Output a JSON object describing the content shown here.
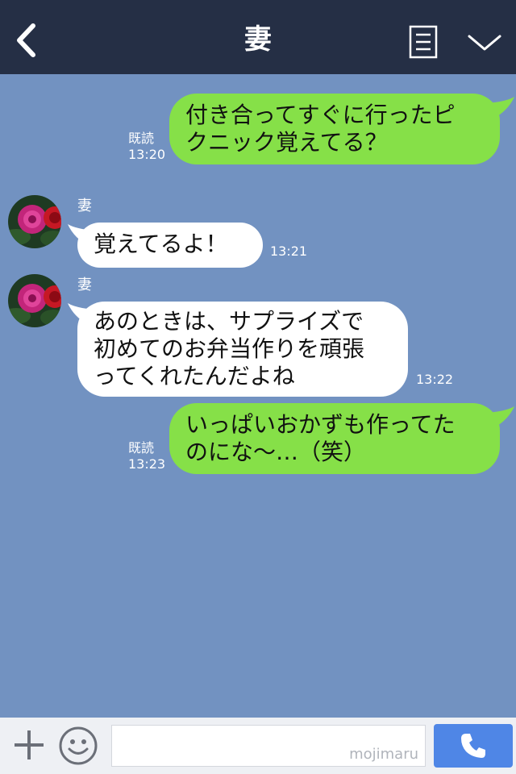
{
  "header": {
    "title": "妻"
  },
  "messages": [
    {
      "side": "right",
      "text": "付き合ってすぐに行ったピ\nクニック覚えてる？",
      "read": "既読",
      "time": "13:20"
    },
    {
      "side": "left",
      "sender": "妻",
      "text": "覚えてるよ！",
      "time": "13:21"
    },
    {
      "side": "left",
      "sender": "妻",
      "text": "あのときは、サプライズで\n初めてのお弁当作りを頑張\nってくれたんだよね",
      "time": "13:22"
    },
    {
      "side": "right",
      "text": "いっぱいおかずも作ってた\nのにな〜…（笑）",
      "read": "既読",
      "time": "13:23"
    }
  ],
  "footer": {
    "watermark": "mojimaru"
  },
  "icons": [
    "back-chevron-icon",
    "note-icon",
    "chevron-down-icon",
    "plus-icon",
    "smiley-icon",
    "phone-icon"
  ],
  "colors": {
    "header_bg": "#252f45",
    "chat_bg": "#7292c1",
    "sent_bubble": "#86e048",
    "received_bubble": "#ffffff",
    "call_button": "#4f86e6"
  }
}
